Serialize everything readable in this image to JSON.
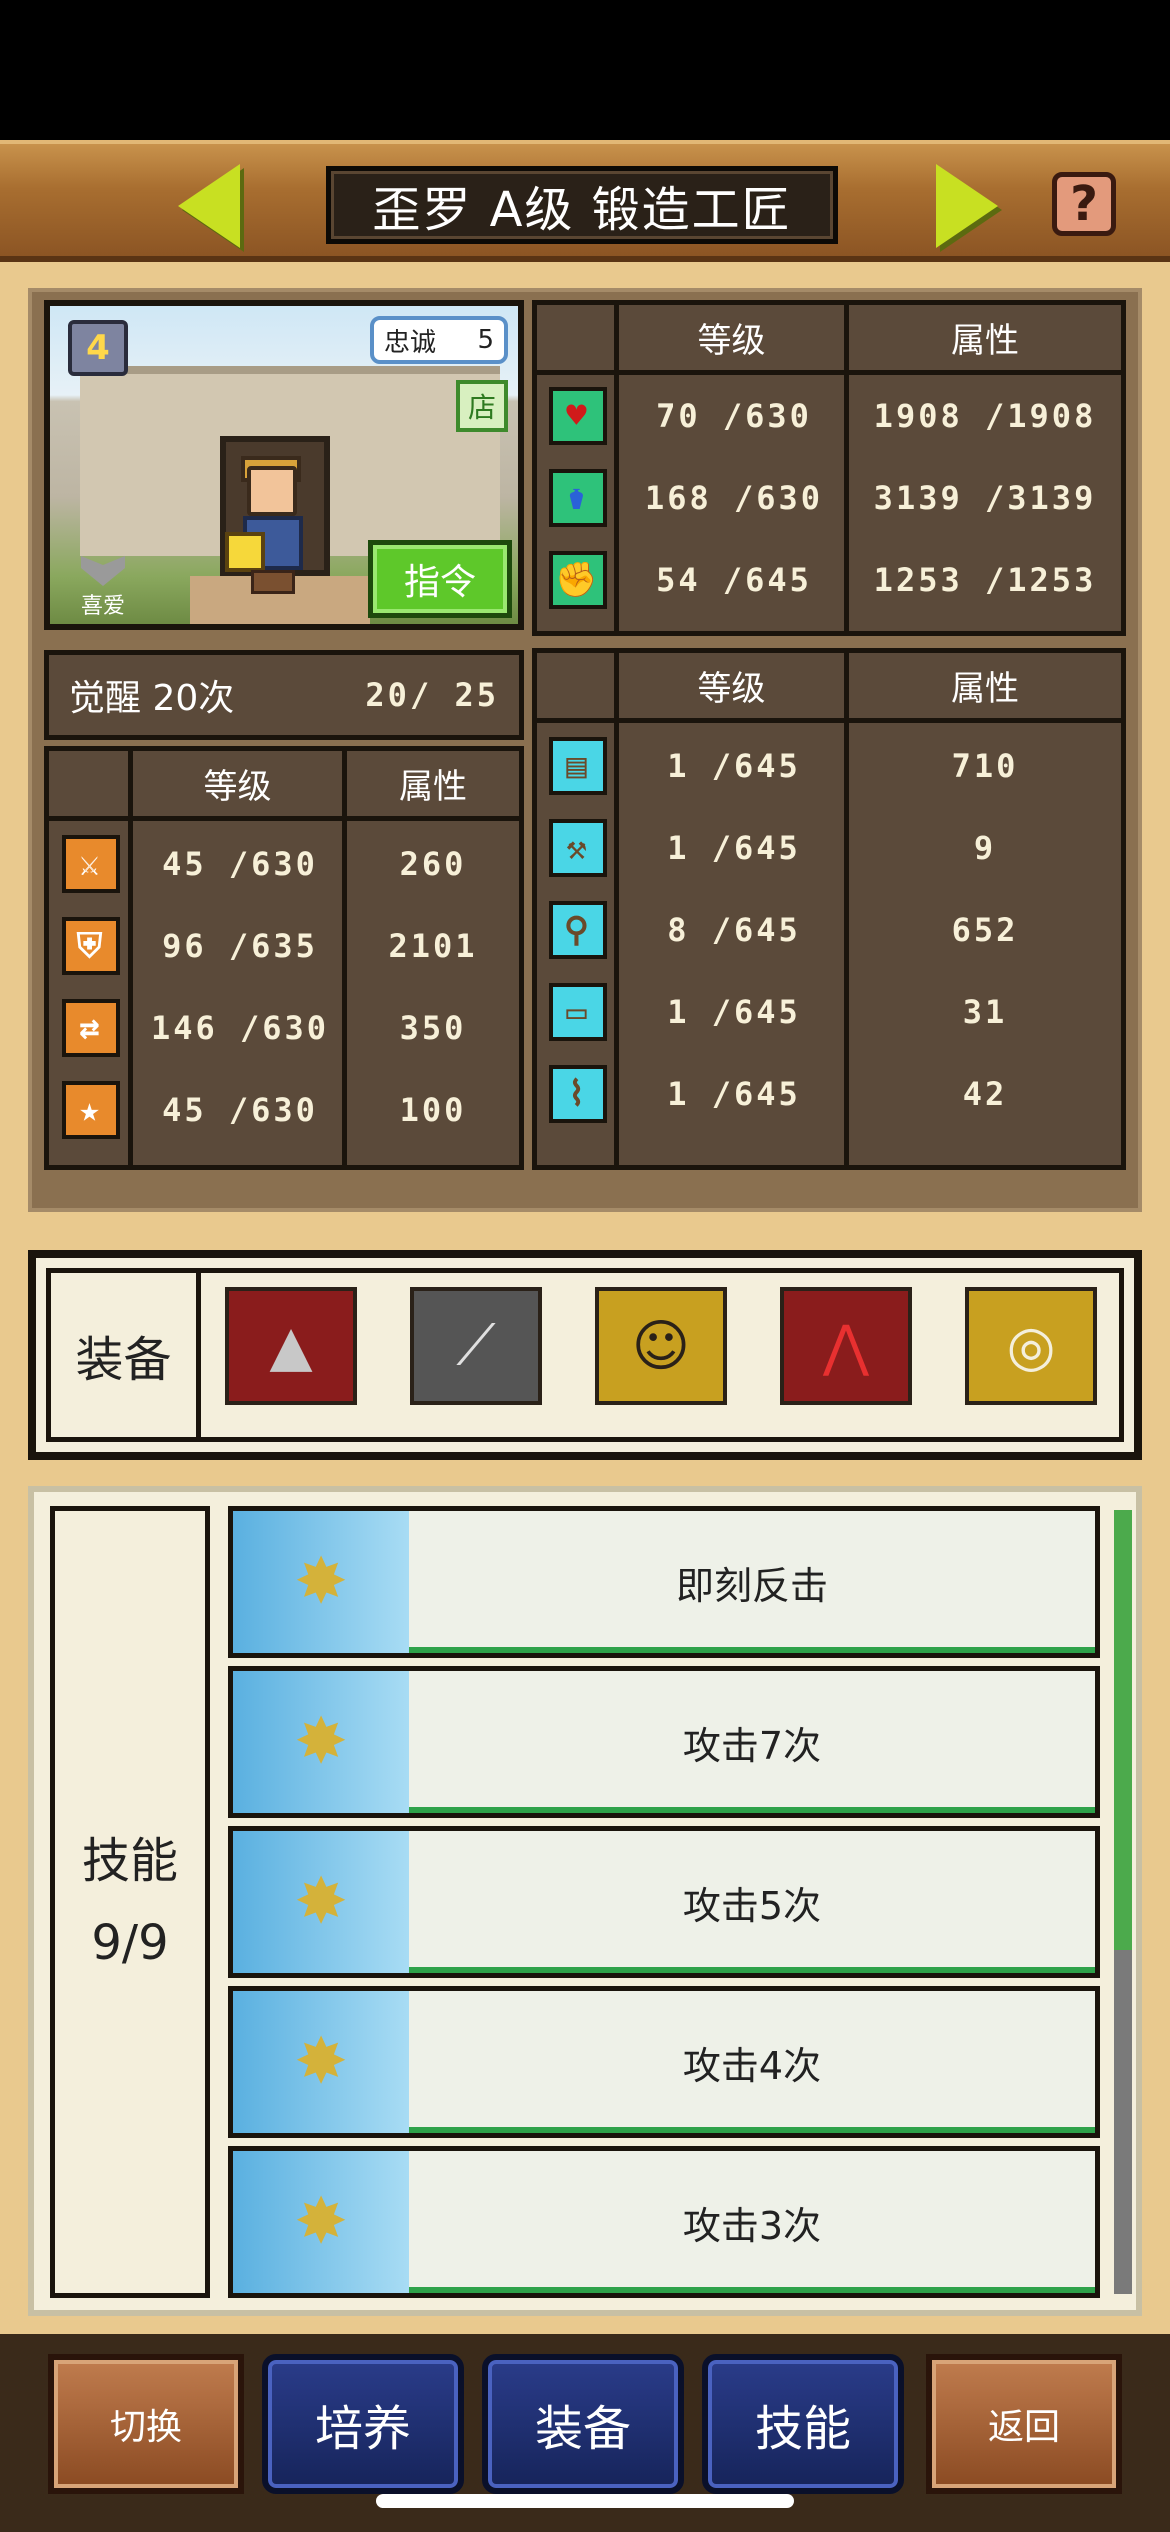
{
  "header": {
    "title": "歪罗 A级 锻造工匠",
    "help_label": "?"
  },
  "portrait": {
    "level_badge": "4",
    "loyalty_label": "忠诚",
    "loyalty_value": "5",
    "shop_label": "店",
    "favorite_label": "喜爱",
    "command_label": "指令"
  },
  "vitals": {
    "headers": [
      "等级",
      "属性"
    ],
    "rows": [
      {
        "icon": "heart-icon",
        "level": "70 /630",
        "value": "1908 /1908"
      },
      {
        "icon": "potion-icon",
        "level": "168 /630",
        "value": "3139 /3139"
      },
      {
        "icon": "strength-arm-icon",
        "level": "54 /645",
        "value": "1253 /1253"
      }
    ]
  },
  "awakening": {
    "label": "觉醒 20次",
    "count": "20/  25"
  },
  "combat": {
    "headers": [
      "等级",
      "属性"
    ],
    "rows": [
      {
        "icon": "sword-icon",
        "level": "45 /630",
        "value": "260"
      },
      {
        "icon": "shield-icon",
        "level": "96 /635",
        "value": "2101"
      },
      {
        "icon": "arrows-icon",
        "level": "146 /630",
        "value": "350"
      },
      {
        "icon": "star-icon",
        "level": "45 /630",
        "value": "100"
      }
    ]
  },
  "crafting": {
    "headers": [
      "等级",
      "属性"
    ],
    "rows": [
      {
        "icon": "book-icon",
        "level": "1 /645",
        "value": "710"
      },
      {
        "icon": "hammer-icon",
        "level": "1 /645",
        "value": "9"
      },
      {
        "icon": "shovel-icon",
        "level": "8 /645",
        "value": "652"
      },
      {
        "icon": "anvil-icon",
        "level": "1 /645",
        "value": "31"
      },
      {
        "icon": "hose-icon",
        "level": "1 /645",
        "value": "42"
      }
    ]
  },
  "equipment": {
    "label": "装备",
    "slots": [
      {
        "icon": "wizard-hat-icon",
        "bg": "#8a1c1c"
      },
      {
        "icon": "bow-icon",
        "bg": "#555555"
      },
      {
        "icon": "smiley-shield-icon",
        "bg": "#c8a020"
      },
      {
        "icon": "red-cape-icon",
        "bg": "#8a1c1c"
      },
      {
        "icon": "ring-icon",
        "bg": "#c8a020"
      }
    ]
  },
  "skills": {
    "label": "技能",
    "count": "9/9",
    "items": [
      {
        "icon": "spark-sword-icon",
        "name": "即刻反击"
      },
      {
        "icon": "spark-sword-icon",
        "name": "攻击7次"
      },
      {
        "icon": "spark-sword-icon",
        "name": "攻击5次"
      },
      {
        "icon": "spark-sword-icon",
        "name": "攻击4次"
      },
      {
        "icon": "spark-sword-icon",
        "name": "攻击3次"
      }
    ]
  },
  "nav": {
    "switch": "切换",
    "train": "培养",
    "equip": "装备",
    "skills": "技能",
    "back": "返回"
  }
}
